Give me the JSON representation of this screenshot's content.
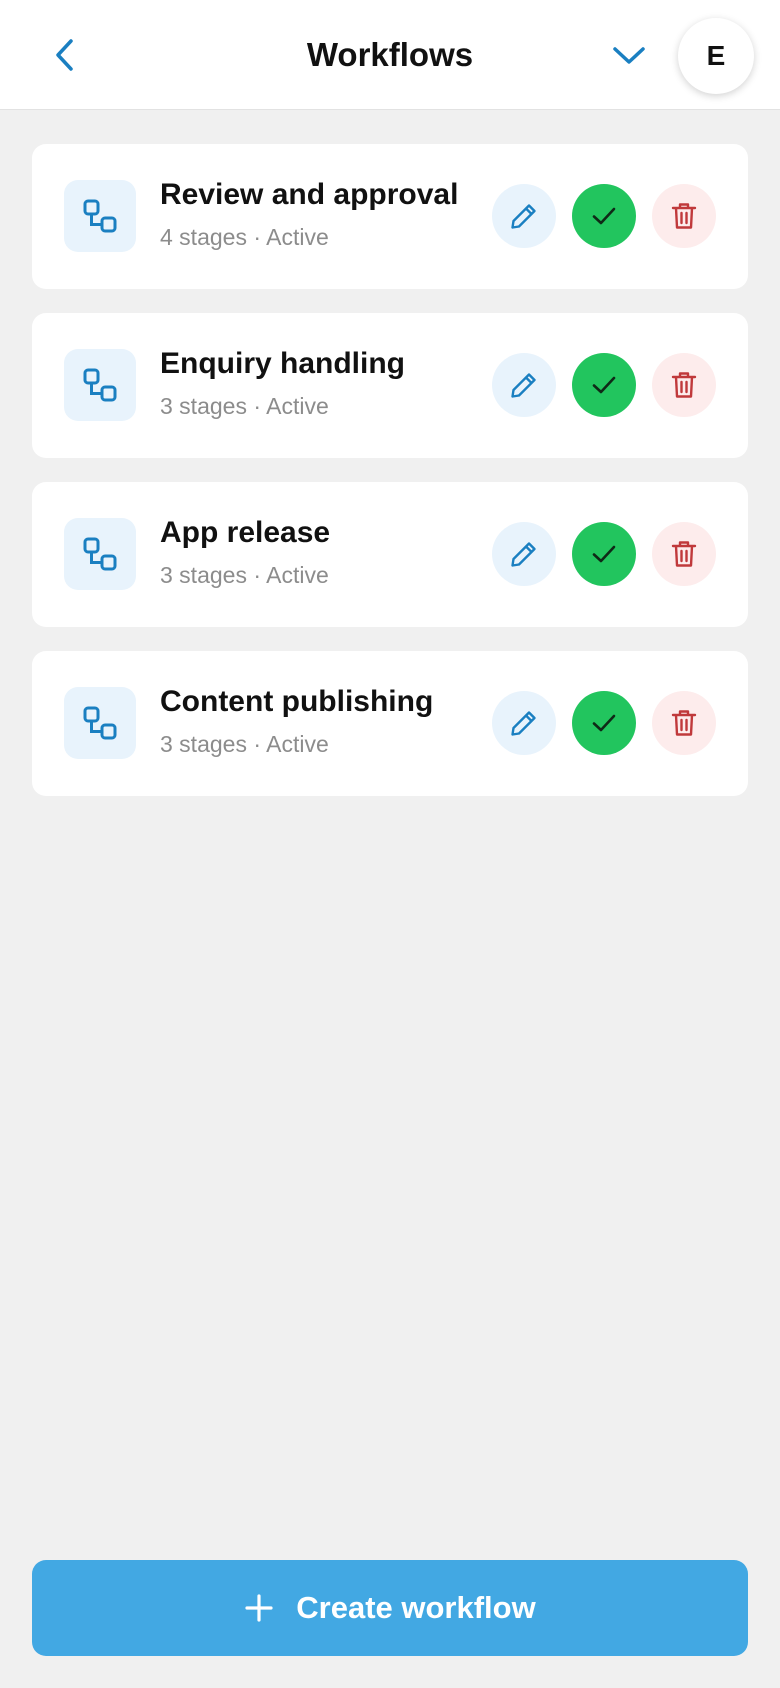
{
  "header": {
    "title": "Workflows",
    "avatar_initial": "E"
  },
  "workflows": [
    {
      "name": "Review and approval",
      "meta": "4 stages · Active"
    },
    {
      "name": "Enquiry handling",
      "meta": "3 stages · Active"
    },
    {
      "name": "App release",
      "meta": "3 stages · Active"
    },
    {
      "name": "Content publishing",
      "meta": "3 stages · Active"
    }
  ],
  "footer": {
    "create_label": "Create workflow"
  },
  "icons": {
    "back": "chevron-left-icon",
    "dropdown": "chevron-down-icon",
    "workflow": "workflow-icon",
    "edit": "pencil-icon",
    "done": "check-icon",
    "delete": "trash-icon",
    "create": "plus-icon"
  },
  "colors": {
    "accent": "#1a7fc1",
    "primary_button": "#42a8e3",
    "success": "#22c55e",
    "danger": "#c0393b",
    "background": "#f0f0f0"
  }
}
